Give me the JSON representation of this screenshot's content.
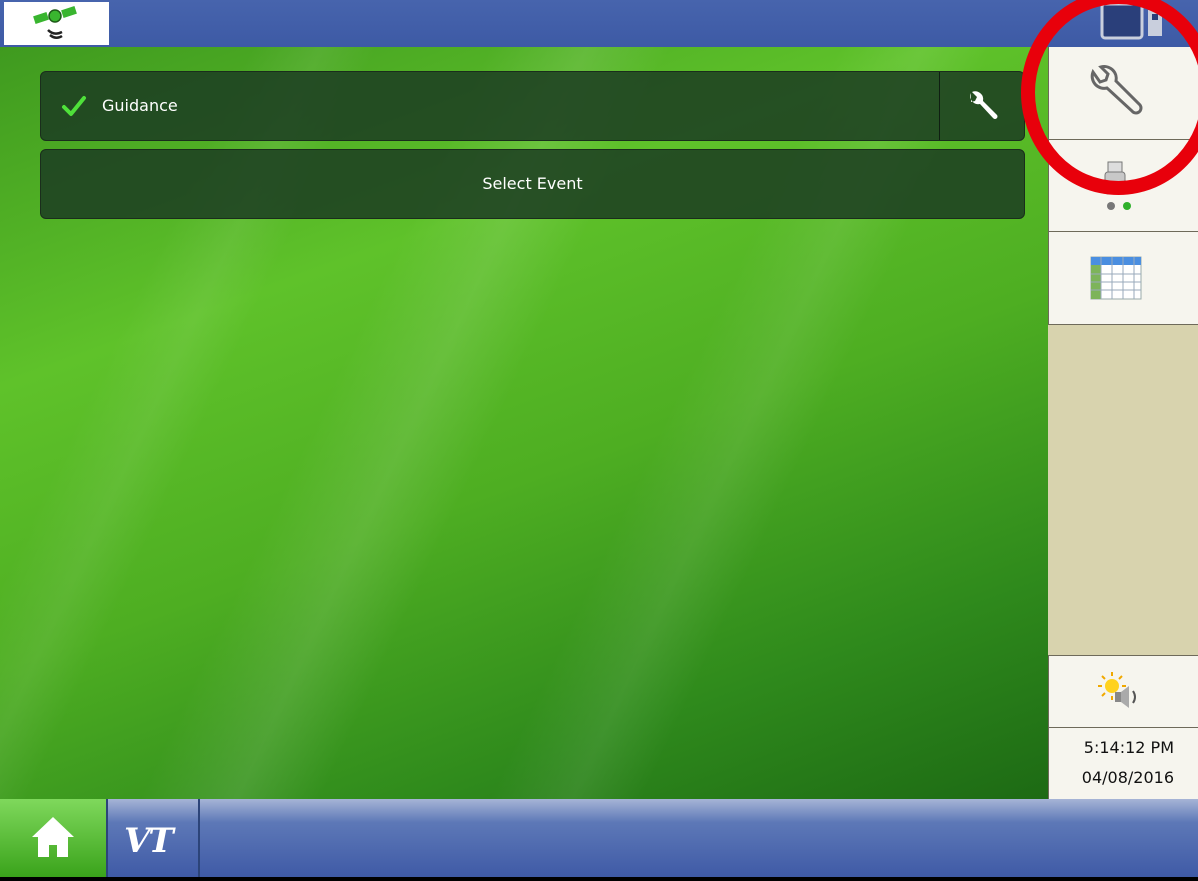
{
  "topbar": {
    "gps_icon": "satellite-gps-icon",
    "display_icon": "display-switch-icon"
  },
  "main": {
    "guidance": {
      "label": "Guidance",
      "status_icon": "checkmark-icon",
      "settings_icon": "wrench-icon"
    },
    "select_event": {
      "label": "Select Event"
    }
  },
  "sidebar": {
    "items": [
      {
        "name": "setup",
        "icon": "wrench-icon"
      },
      {
        "name": "usb",
        "icon": "usb-drive-icon"
      },
      {
        "name": "summary",
        "icon": "table-icon"
      },
      {
        "name": "brightness-volume",
        "icon": "brightness-volume-icon"
      }
    ],
    "clock": {
      "time": "5:14:12 PM",
      "date": "04/08/2016"
    }
  },
  "bottombar": {
    "home_icon": "home-icon",
    "vt_label": "VT"
  },
  "colors": {
    "topbar": "#4764ad",
    "highlight": "#e8000b",
    "row_bg": "#1c3c22",
    "sidebar_bg": "#d8d3ae"
  }
}
